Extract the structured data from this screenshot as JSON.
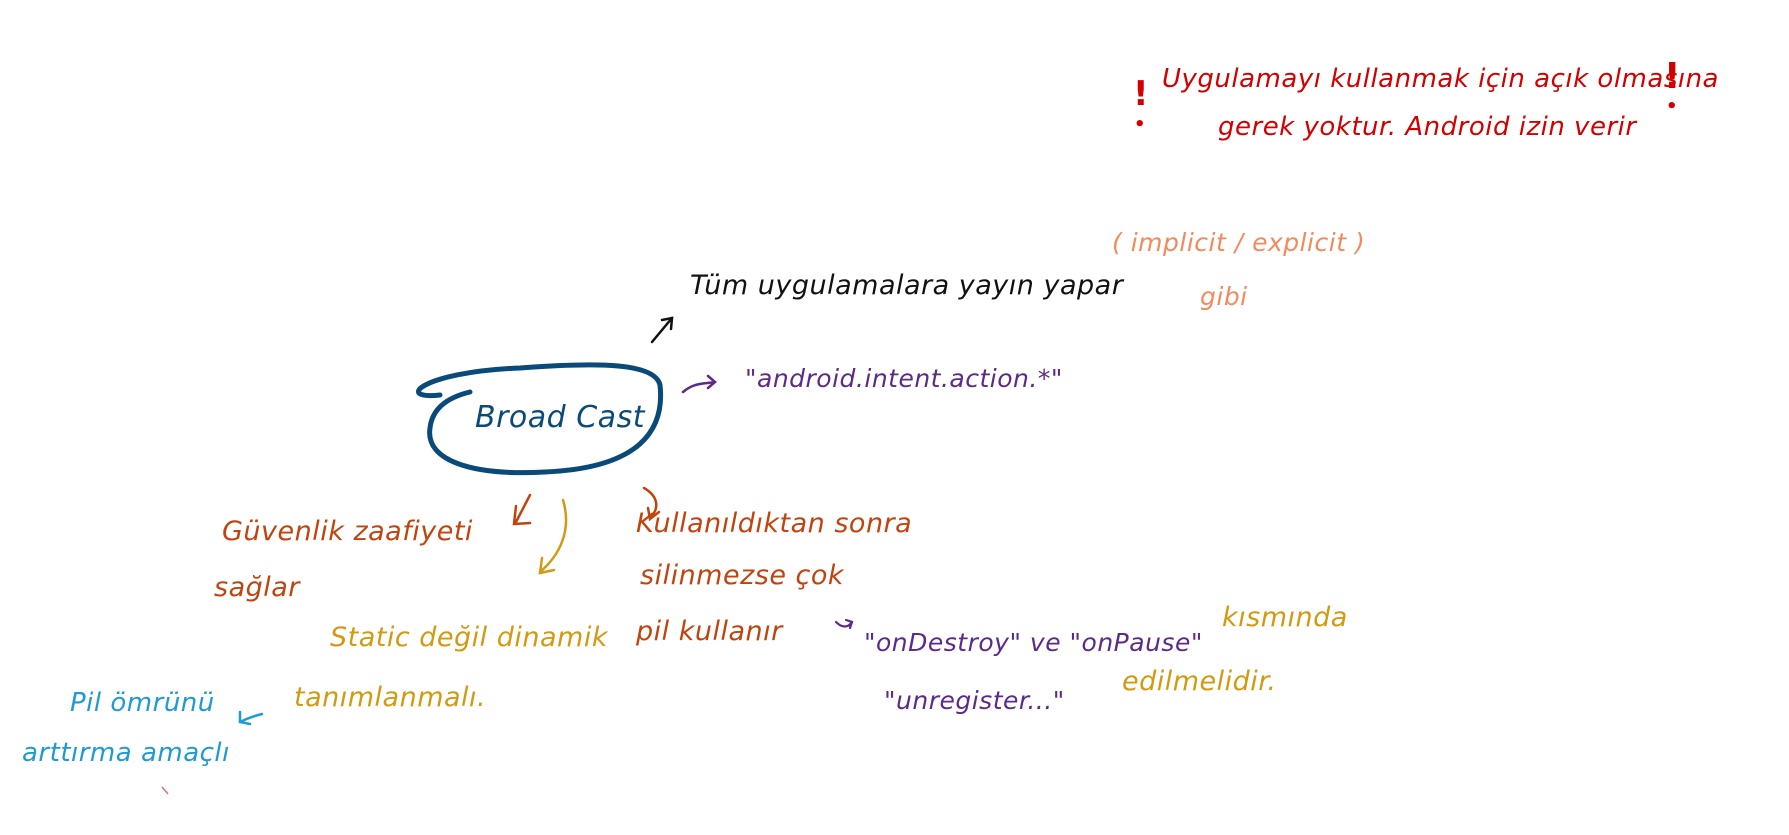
{
  "notes": {
    "warning_line1": "Uygulamayı kullanmak için açık olmasına",
    "warning_line2": "gerek yoktur. Android izin verir",
    "broadcast_desc": "Tüm uygulamalara yayın yapar",
    "implicit_explicit": "( implicit / explicit )",
    "gibi": "gibi",
    "intent_action": "\"android.intent.action.*\"",
    "center_label": "Broad Cast",
    "security_line1": "Güvenlik zaafiyeti",
    "security_line2": "sağlar",
    "unregister_line1": "Kullanıldıktan sonra",
    "unregister_line2": "silinmezse çok",
    "unregister_line3": "pil kullanır",
    "lifecycle_line1_a": "\"onDestroy\" ve \"onPause\"",
    "lifecycle_line1_b": "kısmında",
    "lifecycle_line2_a": "\"unregister...\"",
    "lifecycle_line2_b": "edilmelidir.",
    "static_line1": "Static değil dinamik",
    "static_line2": "tanımlanmalı.",
    "battery_line1": "Pil ömrünü",
    "battery_line2": "arttırma amaçlı"
  },
  "colors": {
    "red": "#d40000",
    "black": "#111111",
    "salmon": "#f28a5c",
    "purple": "#5b2a8a",
    "blue": "#0a4a7a",
    "rust": "#c1440e",
    "gold": "#d29a12",
    "cyan": "#1e9ad6"
  }
}
